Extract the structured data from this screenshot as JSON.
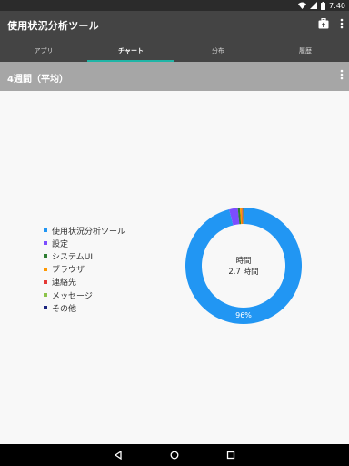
{
  "status": {
    "time": "7:40"
  },
  "app": {
    "title": "使用状況分析ツール"
  },
  "tabs": [
    {
      "label": "アプリ"
    },
    {
      "label": "チャート"
    },
    {
      "label": "分布"
    },
    {
      "label": "履歴"
    }
  ],
  "section": {
    "title": "4週間（平均）"
  },
  "legend": [
    {
      "label": "使用状況分析ツール",
      "color": "#2196f3"
    },
    {
      "label": "設定",
      "color": "#7c4dff"
    },
    {
      "label": "システムUI",
      "color": "#2e7d32"
    },
    {
      "label": "ブラウザ",
      "color": "#ff9800"
    },
    {
      "label": "連絡先",
      "color": "#e53935"
    },
    {
      "label": "メッセージ",
      "color": "#8bc34a"
    },
    {
      "label": "その他",
      "color": "#1a237e"
    }
  ],
  "chart_data": {
    "type": "pie",
    "categories": [
      "使用状況分析ツール",
      "設定",
      "システムUI",
      "ブラウザ",
      "連絡先",
      "メッセージ",
      "その他"
    ],
    "values": [
      96,
      2.4,
      0.6,
      0.5,
      0.2,
      0.2,
      0.1
    ],
    "colors": [
      "#2196f3",
      "#7c4dff",
      "#2e7d32",
      "#ff9800",
      "#e53935",
      "#8bc34a",
      "#1a237e"
    ],
    "center_label": "時間",
    "center_value": "2.7 時間",
    "slice_label": "96%"
  }
}
